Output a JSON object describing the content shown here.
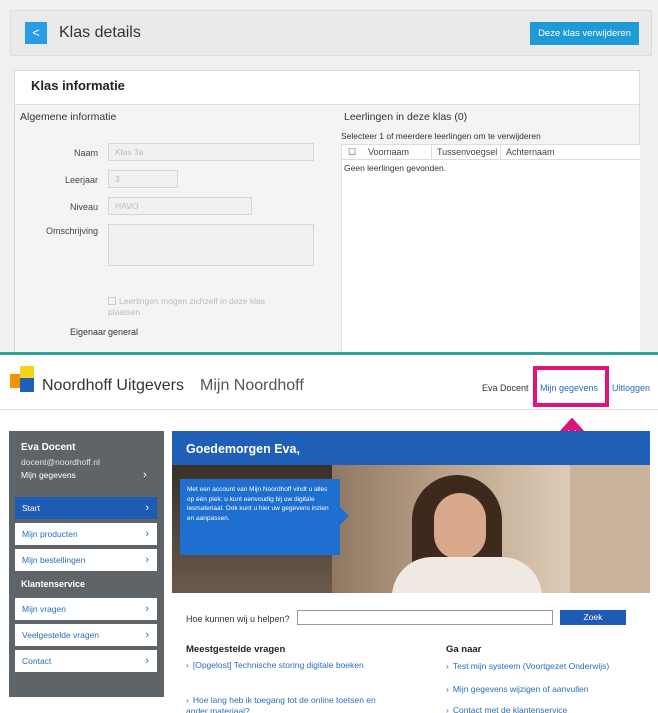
{
  "top_panel": {
    "header_title": "Klas details",
    "back_button": "<",
    "delete_button": "Deze klas verwijderen",
    "card_title": "Klas informatie",
    "general_section": "Algemene informatie",
    "fields": {
      "naam": {
        "label": "Naam",
        "value": "Klas 3a"
      },
      "leerjaar": {
        "label": "Leerjaar",
        "value": "3"
      },
      "niveau": {
        "label": "Niveau",
        "value": "HAVO"
      },
      "omschrijving": {
        "label": "Omschrijving",
        "value": ""
      }
    },
    "self_enroll": "Leerlingen mogen zichzelf in deze klas plaatsen",
    "owner_label": "Eigenaar",
    "owner_value": "general",
    "students_section": "Leerlingen in deze klas (0)",
    "students_hint": "Selecteer 1 of meerdere leerlingen om te verwijderen",
    "columns": [
      "Voornaam",
      "Tussenvoegsel",
      "Achternaam"
    ],
    "empty_message": "Geen leerlingen gevonden."
  },
  "bottom_panel": {
    "brand": "Noordhoff Uitgevers",
    "portal": "Mijn Noordhoff",
    "user_name": "Eva Docent",
    "mijn_gegevens_link": "Mijn gegevens",
    "logout_link": "Uitloggen",
    "sidebar": {
      "name": "Eva Docent",
      "email": "docent@noordhoff.nl",
      "profile_link": "Mijn gegevens",
      "items": [
        {
          "label": "Start",
          "active": true
        },
        {
          "label": "Mijn producten",
          "active": false
        },
        {
          "label": "Mijn bestellingen",
          "active": false
        }
      ],
      "service_section": "Klantenservice",
      "service_items": [
        {
          "label": "Mijn vragen"
        },
        {
          "label": "Veelgestelde vragen"
        },
        {
          "label": "Contact"
        }
      ]
    },
    "greeting": "Goedemorgen Eva,",
    "promo_text": "Met een account van Mijn Noordhoff vindt u alles op één plek: u kunt eenvoudig bij uw digitale lesmateriaal. Ook kunt u hier uw gegevens inzien en aanpassen.",
    "help_label": "Hoe kunnen wij u helpen?",
    "help_placeholder": "",
    "search_button": "Zoek",
    "faq_title": "Meestgestelde vragen",
    "faq_links": [
      "[Opgelost] Technische storing digitale boeken",
      "Hoe lang heb ik toegang tot de online toetsen en ander materiaal?"
    ],
    "goto_title": "Ga naar",
    "goto_links": [
      "Test mijn systeem (Voortgezet Onderwijs)",
      "Mijn gegevens wijzigen of aanvullen",
      "Contact met de klantenservice"
    ]
  },
  "colors": {
    "primary_blue": "#1f5fb8",
    "button_blue": "#1e9ad6",
    "highlight": "#e0137a",
    "divider": "#2aa19a"
  },
  "icons": [
    "back-arrow-icon",
    "chevron-right-icon",
    "up-arrow-icon",
    "logo-icon"
  ]
}
